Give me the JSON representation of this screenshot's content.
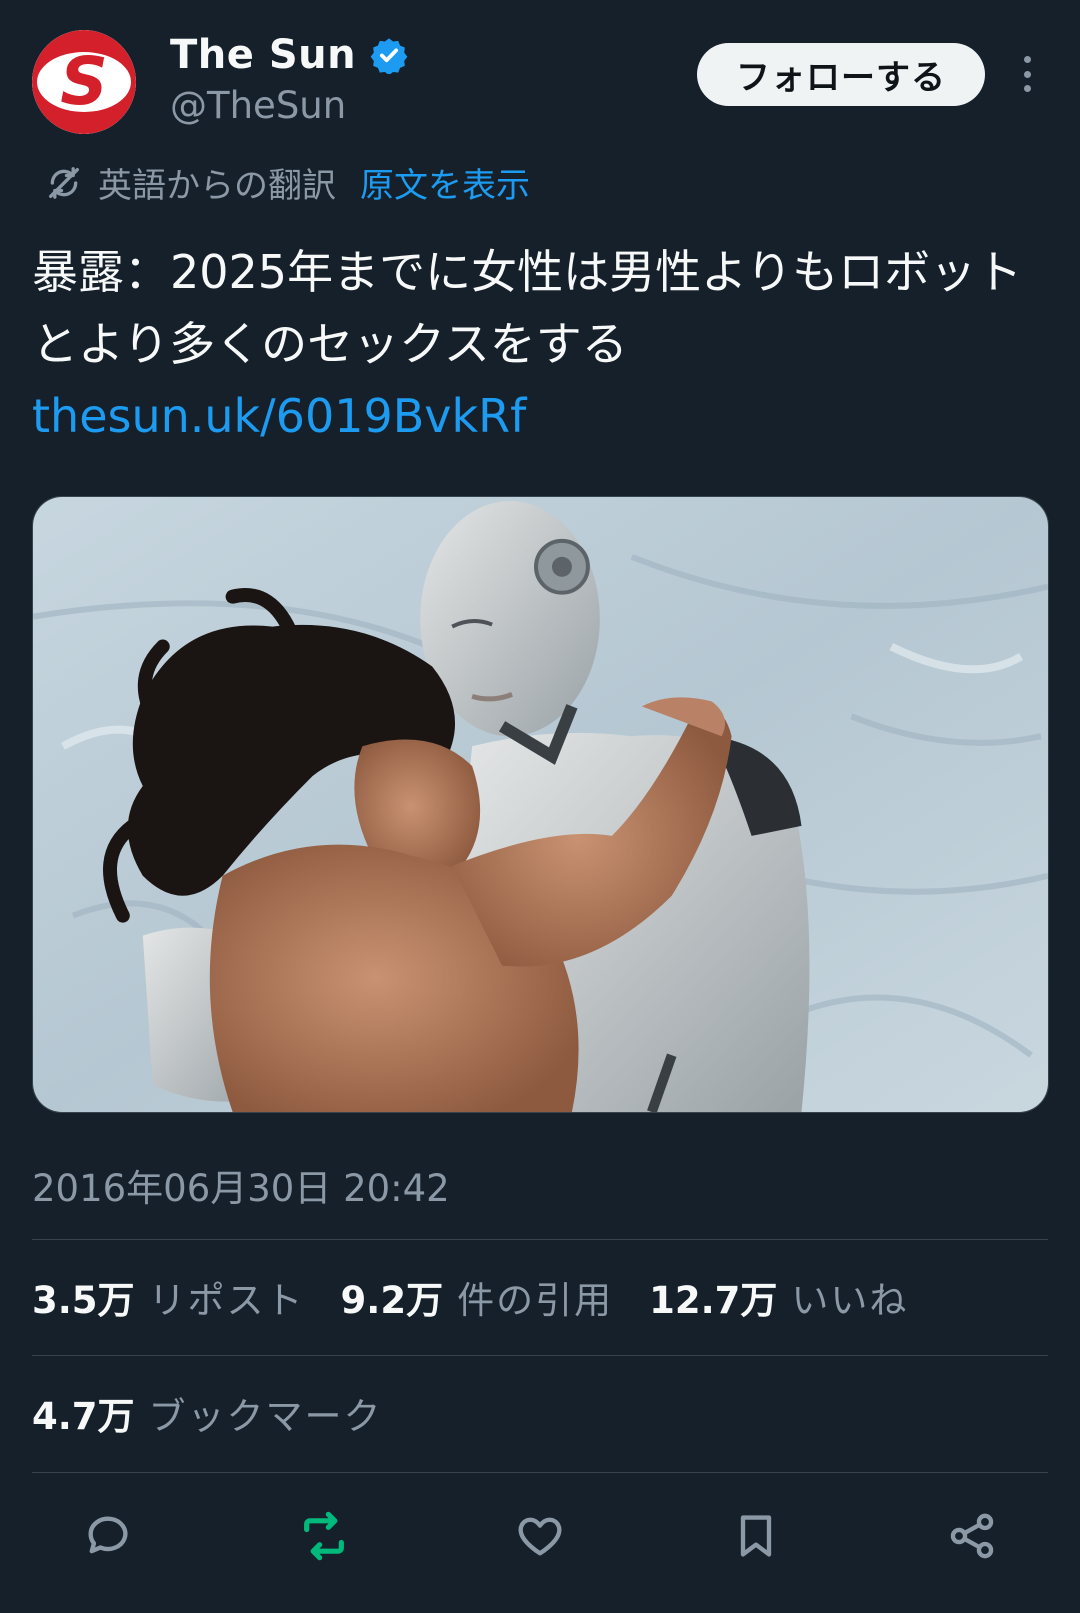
{
  "account": {
    "display_name": "The Sun",
    "handle": "@TheSun",
    "avatar_letter": "S",
    "verified": true
  },
  "header": {
    "follow_label": "フォローする"
  },
  "translation": {
    "label": "英語からの翻訳",
    "show_original": "原文を表示"
  },
  "tweet": {
    "text": "暴露：2025年までに女性は男性よりもロボットとより多くのセックスをする ",
    "link": "thesun.uk/6019BvkRf",
    "timestamp": "2016年06月30日 20:42"
  },
  "stats": {
    "reposts": {
      "count": "3.5万",
      "label": "リポスト"
    },
    "quotes": {
      "count": "9.2万",
      "label": "件の引用"
    },
    "likes": {
      "count": "12.7万",
      "label": "いいね"
    },
    "bookmarks": {
      "count": "4.7万",
      "label": "ブックマーク"
    }
  },
  "actions": {
    "reply": "reply-icon",
    "repost": "repost-icon",
    "like": "heart-icon",
    "bookmark": "bookmark-icon",
    "share": "share-icon"
  },
  "colors": {
    "background": "#15202b",
    "accent": "#1d9bf0",
    "repost_active": "#00ba7c",
    "muted": "#8b98a5",
    "brand_red": "#d4202b"
  }
}
